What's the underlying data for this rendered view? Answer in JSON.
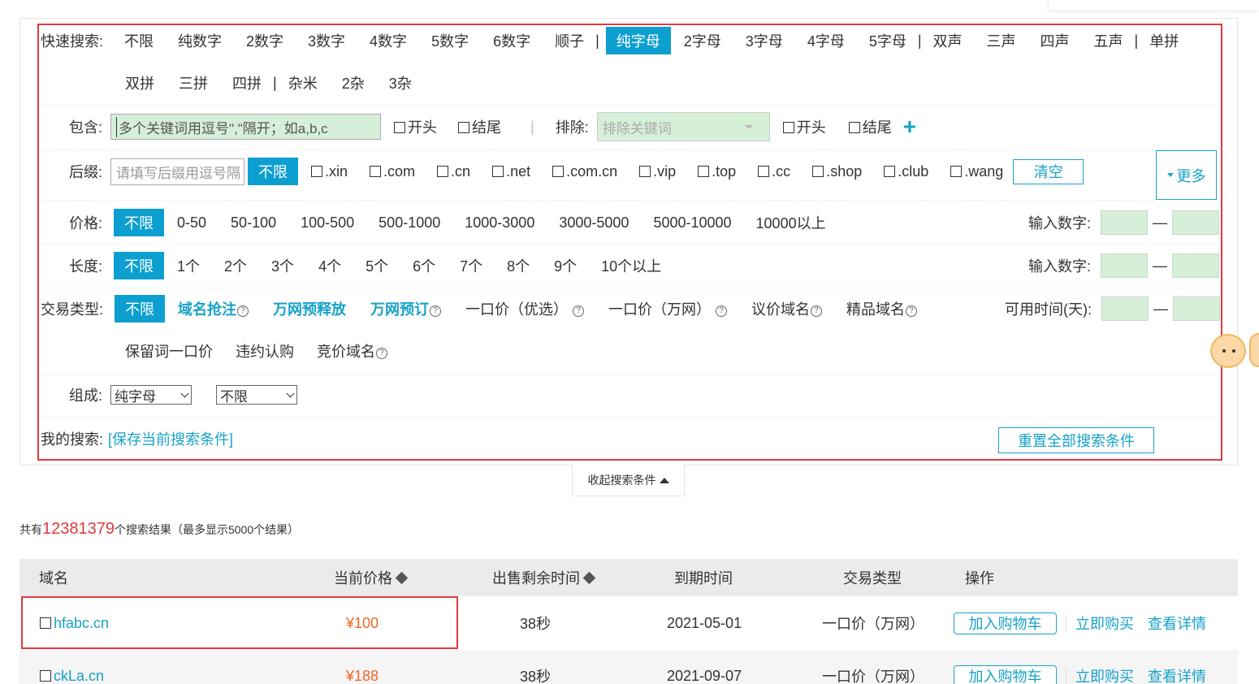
{
  "quick_search": {
    "label": "快速搜索:",
    "row1": [
      "不限",
      "纯数字",
      "2数字",
      "3数字",
      "4数字",
      "5数字",
      "6数字",
      "顺子"
    ],
    "selected": "纯字母",
    "row1b": [
      "2字母",
      "3字母",
      "4字母",
      "5字母"
    ],
    "row1c": [
      "双声",
      "三声",
      "四声",
      "五声"
    ],
    "row1d": [
      "单拼"
    ],
    "row2a": [
      "双拼",
      "三拼",
      "四拼"
    ],
    "row2b": [
      "杂米",
      "2杂",
      "3杂"
    ],
    "bar": "|"
  },
  "include": {
    "label": "包含:",
    "placeholder": "多个关键词用逗号\",\"隔开；如a,b,c",
    "start": "开头",
    "end": "结尾",
    "exclude_label": "排除:",
    "exclude_placeholder": "排除关键词",
    "start2": "开头",
    "end2": "结尾",
    "plus": "+"
  },
  "suffix": {
    "label": "后缀:",
    "placeholder": "请填写后缀用逗号隔",
    "selected": "不限",
    "options": [
      ".xin",
      ".com",
      ".cn",
      ".net",
      ".com.cn",
      ".vip",
      ".top",
      ".cc",
      ".shop",
      ".club",
      ".wang"
    ],
    "clear": "清空",
    "more": "更多"
  },
  "price": {
    "label": "价格:",
    "selected": "不限",
    "options": [
      "0-50",
      "50-100",
      "100-500",
      "500-1000",
      "1000-3000",
      "3000-5000",
      "5000-10000",
      "10000以上"
    ],
    "input_label": "输入数字:"
  },
  "length": {
    "label": "长度:",
    "selected": "不限",
    "options": [
      "1个",
      "2个",
      "3个",
      "4个",
      "5个",
      "6个",
      "7个",
      "8个",
      "9个",
      "10个以上"
    ],
    "input_label": "输入数字:"
  },
  "trade_type": {
    "label": "交易类型:",
    "selected": "不限",
    "bold_options": [
      "域名抢注",
      "万网预释放",
      "万网预订"
    ],
    "options": [
      "一口价（优选）",
      "一口价（万网）",
      "议价域名",
      "精品域名"
    ],
    "row2": [
      "保留词一口价",
      "违约认购",
      "竞价域名"
    ],
    "q": "?",
    "input_label": "可用时间(天):"
  },
  "composition": {
    "label": "组成:",
    "select1": "纯字母",
    "select2": "不限"
  },
  "my_search": {
    "label": "我的搜索:",
    "save_link": "[保存当前搜索条件]",
    "reset": "重置全部搜索条件"
  },
  "collapse": "收起搜索条件",
  "results": {
    "prefix": "共有",
    "count": "12381379",
    "suffix": "个搜索结果（最多显示5000个结果）"
  },
  "table": {
    "headers": {
      "domain": "域名",
      "price": "当前价格",
      "remaining": "出售剩余时间",
      "expiry": "到期时间",
      "type": "交易类型",
      "ops": "操作"
    },
    "rows": [
      {
        "domain": "hfabc.cn",
        "price": "¥100",
        "remaining": "38秒",
        "expiry": "2021-05-01",
        "type": "一口价（万网）",
        "cart": "加入购物车",
        "buy": "立即购买",
        "detail": "查看详情"
      },
      {
        "domain": "ckLa.cn",
        "price": "¥188",
        "remaining": "38秒",
        "expiry": "2021-09-07",
        "type": "一口价（万网）",
        "cart": "加入购物车",
        "buy": "立即购买",
        "detail": "查看详情"
      }
    ]
  },
  "colors": {
    "accent": "#0d9fd0",
    "highlight": "#e0393e",
    "price": "#f26522"
  }
}
